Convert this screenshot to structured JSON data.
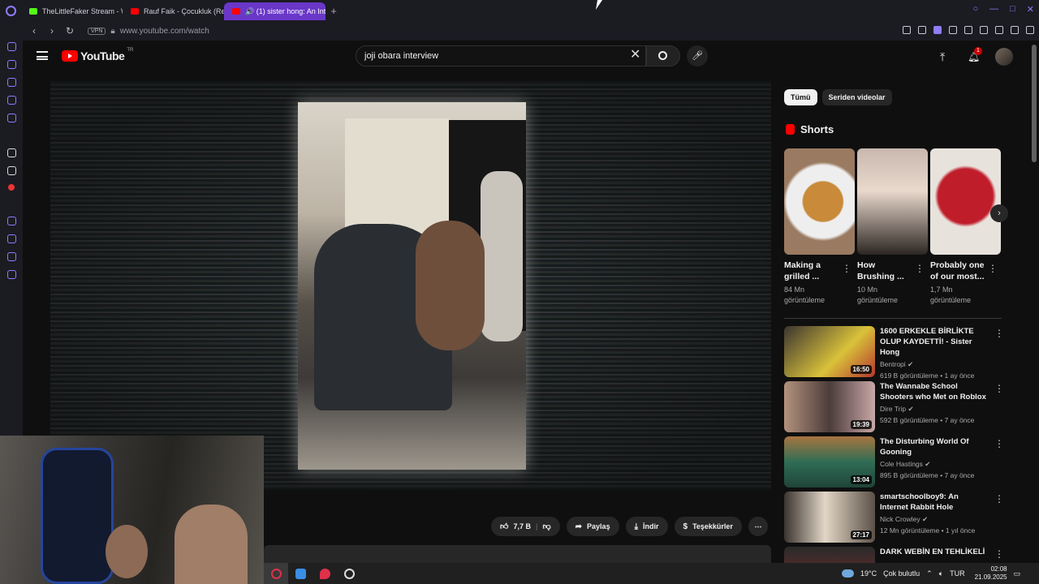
{
  "browser": {
    "tabs": [
      {
        "title": "TheLittleFaker Stream - W",
        "icon": "kick-icon",
        "color": "#53fc18"
      },
      {
        "title": "Rauf Faik - Çocukluk (Re",
        "icon": "youtube-icon",
        "color": "#ff0000"
      },
      {
        "title": "🔊 (1) sister hong: An Inte",
        "icon": "youtube-icon",
        "color": "#ff0000"
      }
    ],
    "new_tab": "+",
    "vpn": "VPN",
    "url": "www.youtube.com/watch",
    "accent": "#6a37c9"
  },
  "youtube": {
    "logo": "YouTube",
    "region": "TR",
    "search_value": "joji obara interview",
    "notification_count": "1"
  },
  "actions": {
    "likes": "7,7 B",
    "share": "Paylaş",
    "download": "İndir",
    "thanks": "Teşekkürler"
  },
  "chips": [
    "Tümü",
    "Seriden videolar"
  ],
  "shorts": {
    "heading": "Shorts",
    "items": [
      {
        "title": "Making a grilled ...",
        "views": "84 Mn görüntüleme",
        "thumb": "#c98a3a"
      },
      {
        "title": "How Brushing ...",
        "views": "10 Mn görüntüleme",
        "thumb": "#6e5a50"
      },
      {
        "title": "Probably one of our most...",
        "views": "1,7 Mn görüntüleme",
        "thumb": "#c01d2b"
      }
    ]
  },
  "videos": [
    {
      "title": "1600 ERKEKLE BİRLİKTE OLUP KAYDETTİ! - Sister Hong",
      "channel": "Bentropi",
      "meta": "619 B görüntüleme • 1 ay önce",
      "duration": "16:50",
      "thumb": "#d9c23a"
    },
    {
      "title": "The Wannabe School Shooters who Met on Roblox",
      "channel": "Dire Trip",
      "meta": "592 B görüntüleme • 7 ay önce",
      "duration": "19:39",
      "thumb": "#7a5a5a"
    },
    {
      "title": "The Disturbing World Of Gooning",
      "channel": "Cole Hastings",
      "meta": "895 B görüntüleme • 7 ay önce",
      "duration": "13:04",
      "thumb": "#2f6d55"
    },
    {
      "title": "smartschoolboy9: An Internet Rabbit Hole",
      "channel": "Nick Crowley",
      "meta": "12 Mn görüntüleme • 1 yıl önce",
      "duration": "27:17",
      "thumb": "#5b5147"
    },
    {
      "title": "DARK WEBİN EN TEHLİKELİ",
      "channel": "",
      "meta": "",
      "duration": "",
      "thumb": "#8a2e2e"
    }
  ],
  "taskbar": {
    "temp": "19°C",
    "weather": "Çok bulutlu",
    "lang": "TUR",
    "time": "02:08",
    "date": "21.09.2025"
  }
}
